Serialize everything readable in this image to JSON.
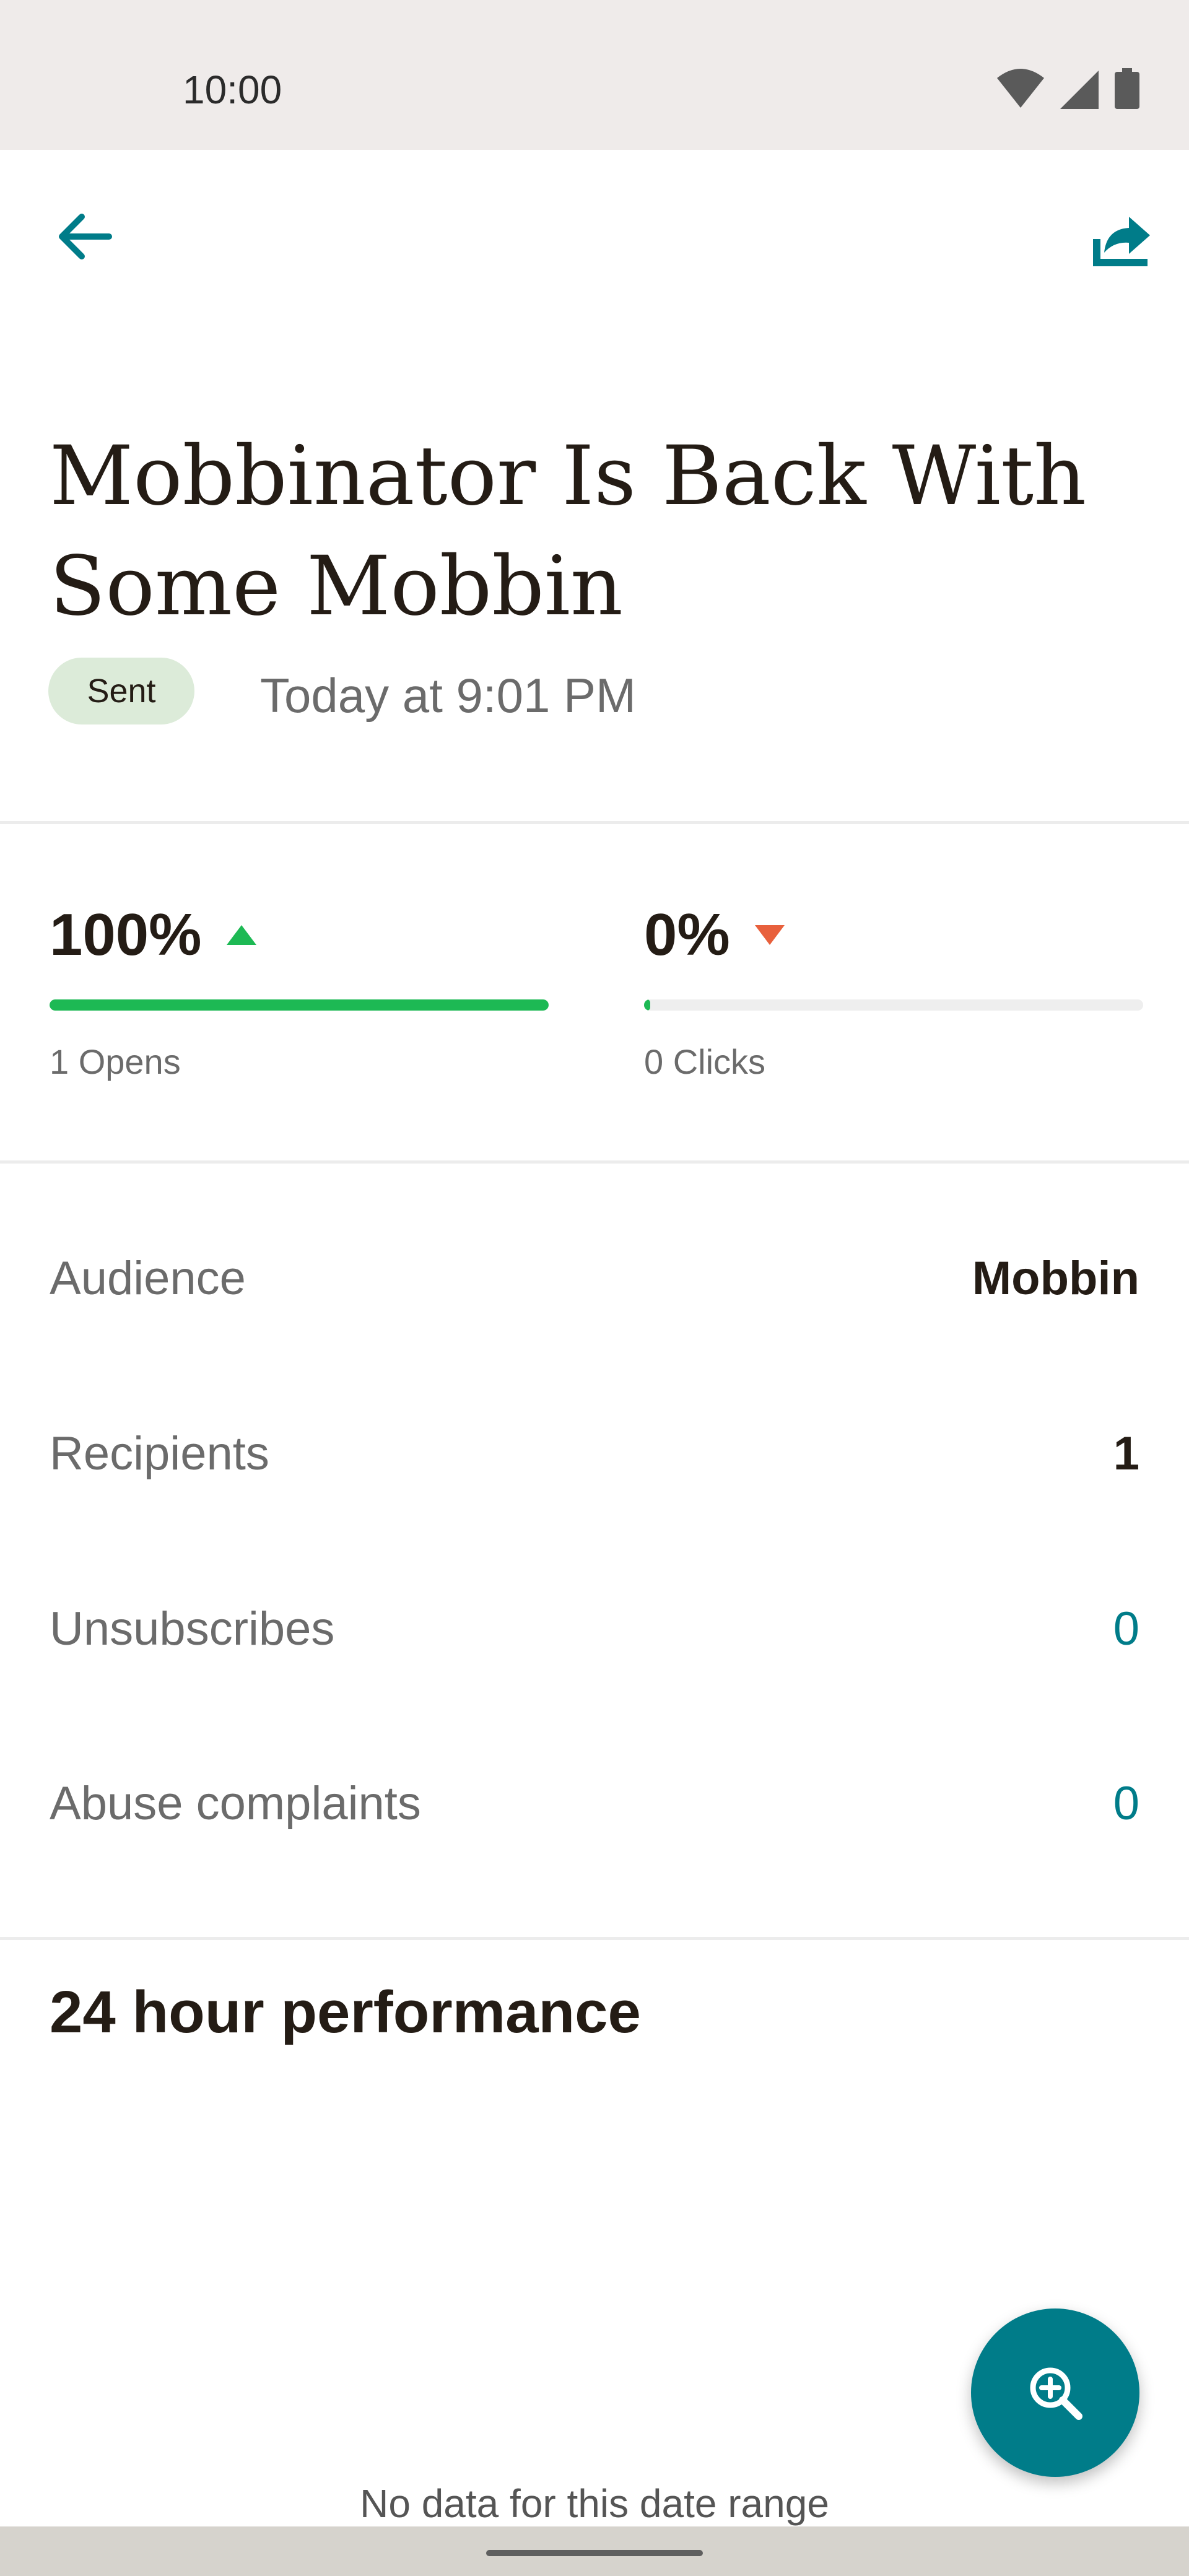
{
  "status_bar": {
    "time": "10:00",
    "icons": [
      "wifi-icon",
      "signal-icon",
      "battery-icon"
    ]
  },
  "app_bar": {
    "back_icon": "arrow-left-icon",
    "share_icon": "share-icon"
  },
  "campaign": {
    "title": "Mobbinator Is Back With Some Mobbin",
    "status": "Sent",
    "sent_time": "Today at 9:01 PM"
  },
  "stats": {
    "opens": {
      "value": "100%",
      "trend": "up",
      "progress": 1.0,
      "label": "1 Opens",
      "color": "#1db954"
    },
    "clicks": {
      "value": "0%",
      "trend": "down",
      "progress": 0.0,
      "label": "0 Clicks",
      "color": "#1db954"
    }
  },
  "details": [
    {
      "label": "Audience",
      "value": "Mobbin",
      "style": "bold"
    },
    {
      "label": "Recipients",
      "value": "1",
      "style": "bold"
    },
    {
      "label": "Unsubscribes",
      "value": "0",
      "style": "link"
    },
    {
      "label": "Abuse complaints",
      "value": "0",
      "style": "link"
    }
  ],
  "performance": {
    "title": "24 hour performance",
    "empty_message": "No data for this date range",
    "zoom_icon": "zoom-in-icon"
  },
  "colors": {
    "accent": "#007c89",
    "up": "#1db954",
    "down": "#e8603c",
    "badge_bg": "#dcebd9"
  }
}
